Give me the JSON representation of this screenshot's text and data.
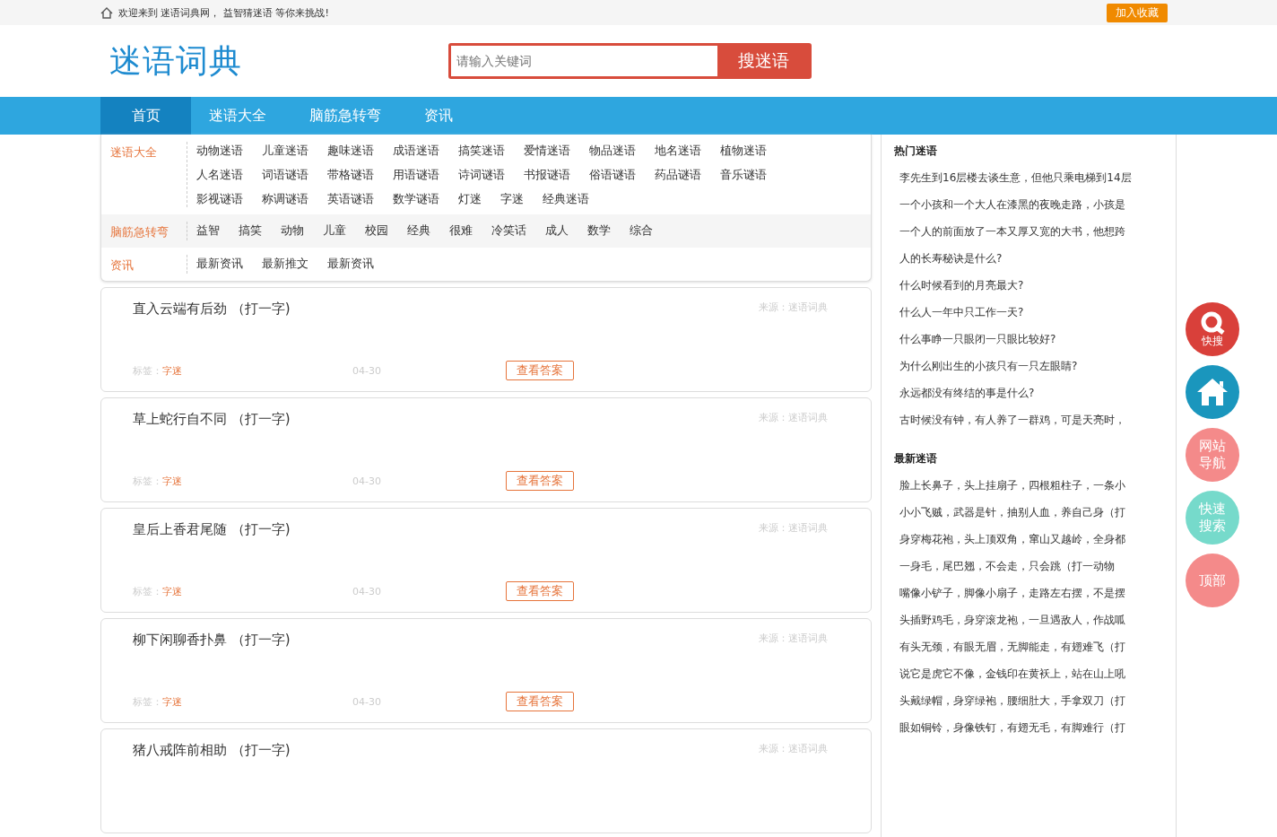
{
  "topbar": {
    "welcome": "欢迎来到 迷语词典网， 益智猜迷语 等你来挑战!",
    "favorite": "加入收藏"
  },
  "header": {
    "logo": "迷语词典",
    "search": {
      "placeholder": "请输入关键词",
      "button": "搜迷语"
    }
  },
  "nav": [
    {
      "label": "首页",
      "selected": true
    },
    {
      "label": "迷语大全",
      "selected": false
    },
    {
      "label": "脑筋急转弯",
      "selected": false
    },
    {
      "label": "资讯",
      "selected": false
    }
  ],
  "categories": [
    {
      "title": "迷语大全",
      "links": [
        "动物迷语",
        "儿童迷语",
        "趣味迷语",
        "成语迷语",
        "搞笑迷语",
        "爱情迷语",
        "物品迷语",
        "地名迷语",
        "植物迷语",
        "人名迷语",
        "词语谜语",
        "带格谜语",
        "用语谜语",
        "诗词谜语",
        "书报谜语",
        "俗语谜语",
        "药品谜语",
        "音乐谜语",
        "影视谜语",
        "称调谜语",
        "英语谜语",
        "数学谜语",
        "灯迷",
        "字迷",
        "经典迷语"
      ]
    },
    {
      "title": "脑筋急转弯",
      "links": [
        "益智",
        "搞笑",
        "动物",
        "儿童",
        "校园",
        "经典",
        "很难",
        "冷笑话",
        "成人",
        "数学",
        "综合"
      ]
    },
    {
      "title": "资讯",
      "links": [
        "最新资讯",
        "最新推文",
        "最新资讯"
      ]
    }
  ],
  "riddles": [
    {
      "title": "直入云端有后劲 （打一字)",
      "source": "来源：迷语词典",
      "tag_label": "标签：",
      "tag": "字迷",
      "date": "04-30",
      "button": "查看答案"
    },
    {
      "title": "草上蛇行自不同 （打一字)",
      "source": "来源：迷语词典",
      "tag_label": "标签：",
      "tag": "字迷",
      "date": "04-30",
      "button": "查看答案"
    },
    {
      "title": "皇后上香君尾随 （打一字)",
      "source": "来源：迷语词典",
      "tag_label": "标签：",
      "tag": "字迷",
      "date": "04-30",
      "button": "查看答案"
    },
    {
      "title": "柳下闲聊香扑鼻 （打一字)",
      "source": "来源：迷语词典",
      "tag_label": "标签：",
      "tag": "字迷",
      "date": "04-30",
      "button": "查看答案"
    },
    {
      "title": "猪八戒阵前相助 （打一字)",
      "source": "来源：迷语词典"
    }
  ],
  "sidebar": [
    {
      "heading": "热门迷语",
      "items": [
        "李先生到16层楼去谈生意，但他只乘电梯到14层",
        "一个小孩和一个大人在漆黑的夜晚走路，小孩是",
        "一个人的前面放了一本又厚又宽的大书，他想跨",
        "人的长寿秘诀是什么?",
        "什么时候看到的月亮最大?",
        "什么人一年中只工作一天?",
        "什么事睁一只眼闭一只眼比较好?",
        "为什么刚出生的小孩只有一只左眼睛?",
        "永远都没有终结的事是什么?",
        "古时候没有钟，有人养了一群鸡，可是天亮时，"
      ]
    },
    {
      "heading": "最新迷语",
      "items": [
        "脸上长鼻子，头上挂扇子，四根粗柱子，一条小",
        "小小飞贼，武器是针，抽别人血，养自己身（打",
        "身穿梅花袍，头上顶双角，窜山又越岭，全身都",
        "一身毛，尾巴翘，不会走，只会跳（打一动物",
        "嘴像小铲子，脚像小扇子，走路左右摆，不是摆",
        "头插野鸡毛，身穿滚龙袍，一旦遇敌人，作战呱",
        "有头无颈，有眼无眉，无脚能走，有翅难飞（打",
        "说它是虎它不像，金钱印在黄袄上，站在山上吼",
        "头戴绿帽，身穿绿袍，腰细肚大，手拿双刀（打",
        "眼如铜铃，身像铁钉，有翅无毛，有脚难行（打"
      ]
    }
  ],
  "float_buttons": [
    {
      "kind": "search",
      "label": "快搜",
      "color": "#d9403a"
    },
    {
      "kind": "home",
      "color": "#1a96bd"
    },
    {
      "kind": "text",
      "label": "网站导航",
      "color": "#f48a8a"
    },
    {
      "kind": "text",
      "label": "快速搜索",
      "color": "#76dacb"
    },
    {
      "kind": "text",
      "label": "顶部",
      "color": "#f48a8a"
    }
  ]
}
